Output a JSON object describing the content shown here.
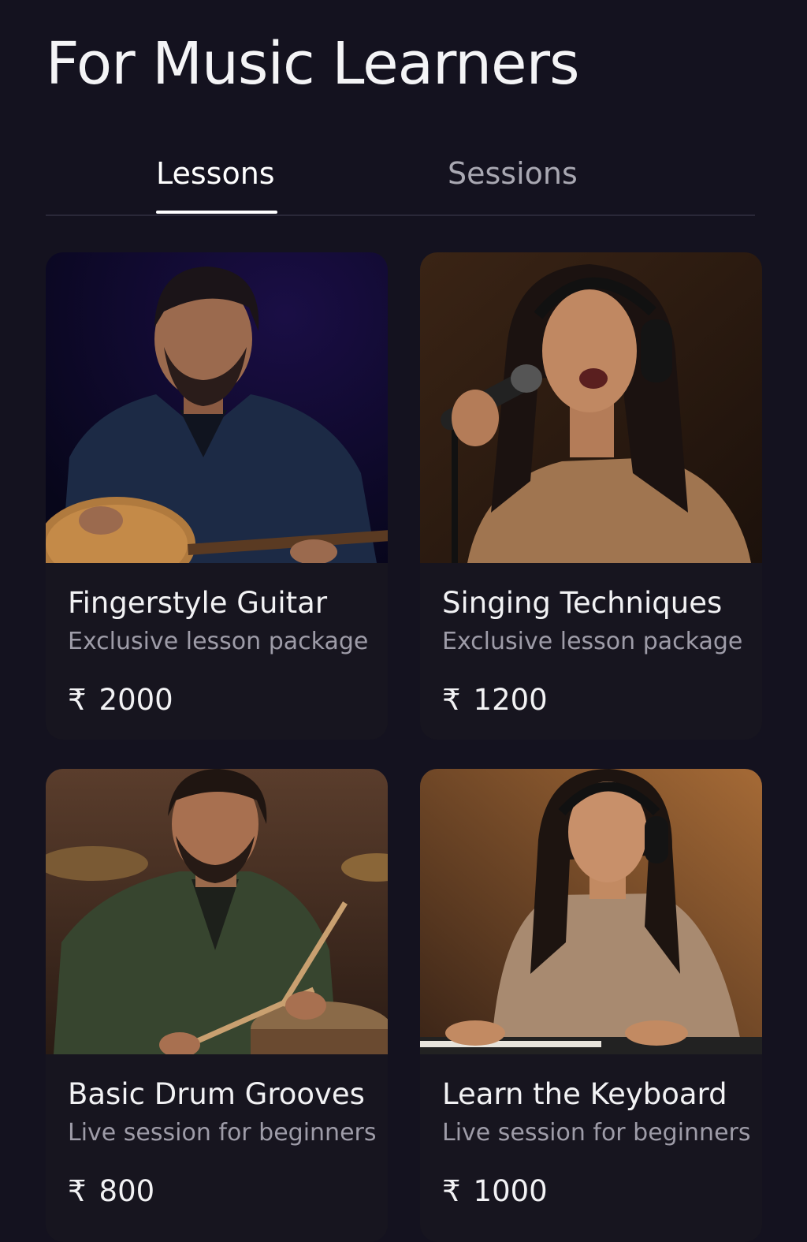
{
  "page": {
    "title": "For Music Learners"
  },
  "tabs": [
    {
      "label": "Lessons",
      "active": true
    },
    {
      "label": "Sessions",
      "active": false
    }
  ],
  "currency_symbol": "₹",
  "cards": [
    {
      "title": "Fingerstyle Guitar",
      "subtitle": "Exclusive lesson package",
      "price": "2000",
      "photo_icon": "guitarist-photo"
    },
    {
      "title": "Singing Techniques",
      "subtitle": "Exclusive lesson package",
      "price": "1200",
      "photo_icon": "singer-photo"
    },
    {
      "title": "Basic Drum Grooves",
      "subtitle": "Live session for beginners",
      "price": "800",
      "photo_icon": "drummer-photo"
    },
    {
      "title": "Learn the Keyboard",
      "subtitle": "Live session for beginners",
      "price": "1000",
      "photo_icon": "keyboardist-photo"
    }
  ],
  "colors": {
    "background": "#14121f",
    "card": "#17151f",
    "text_primary": "#ffffff",
    "text_secondary": "#9e9ca8"
  }
}
